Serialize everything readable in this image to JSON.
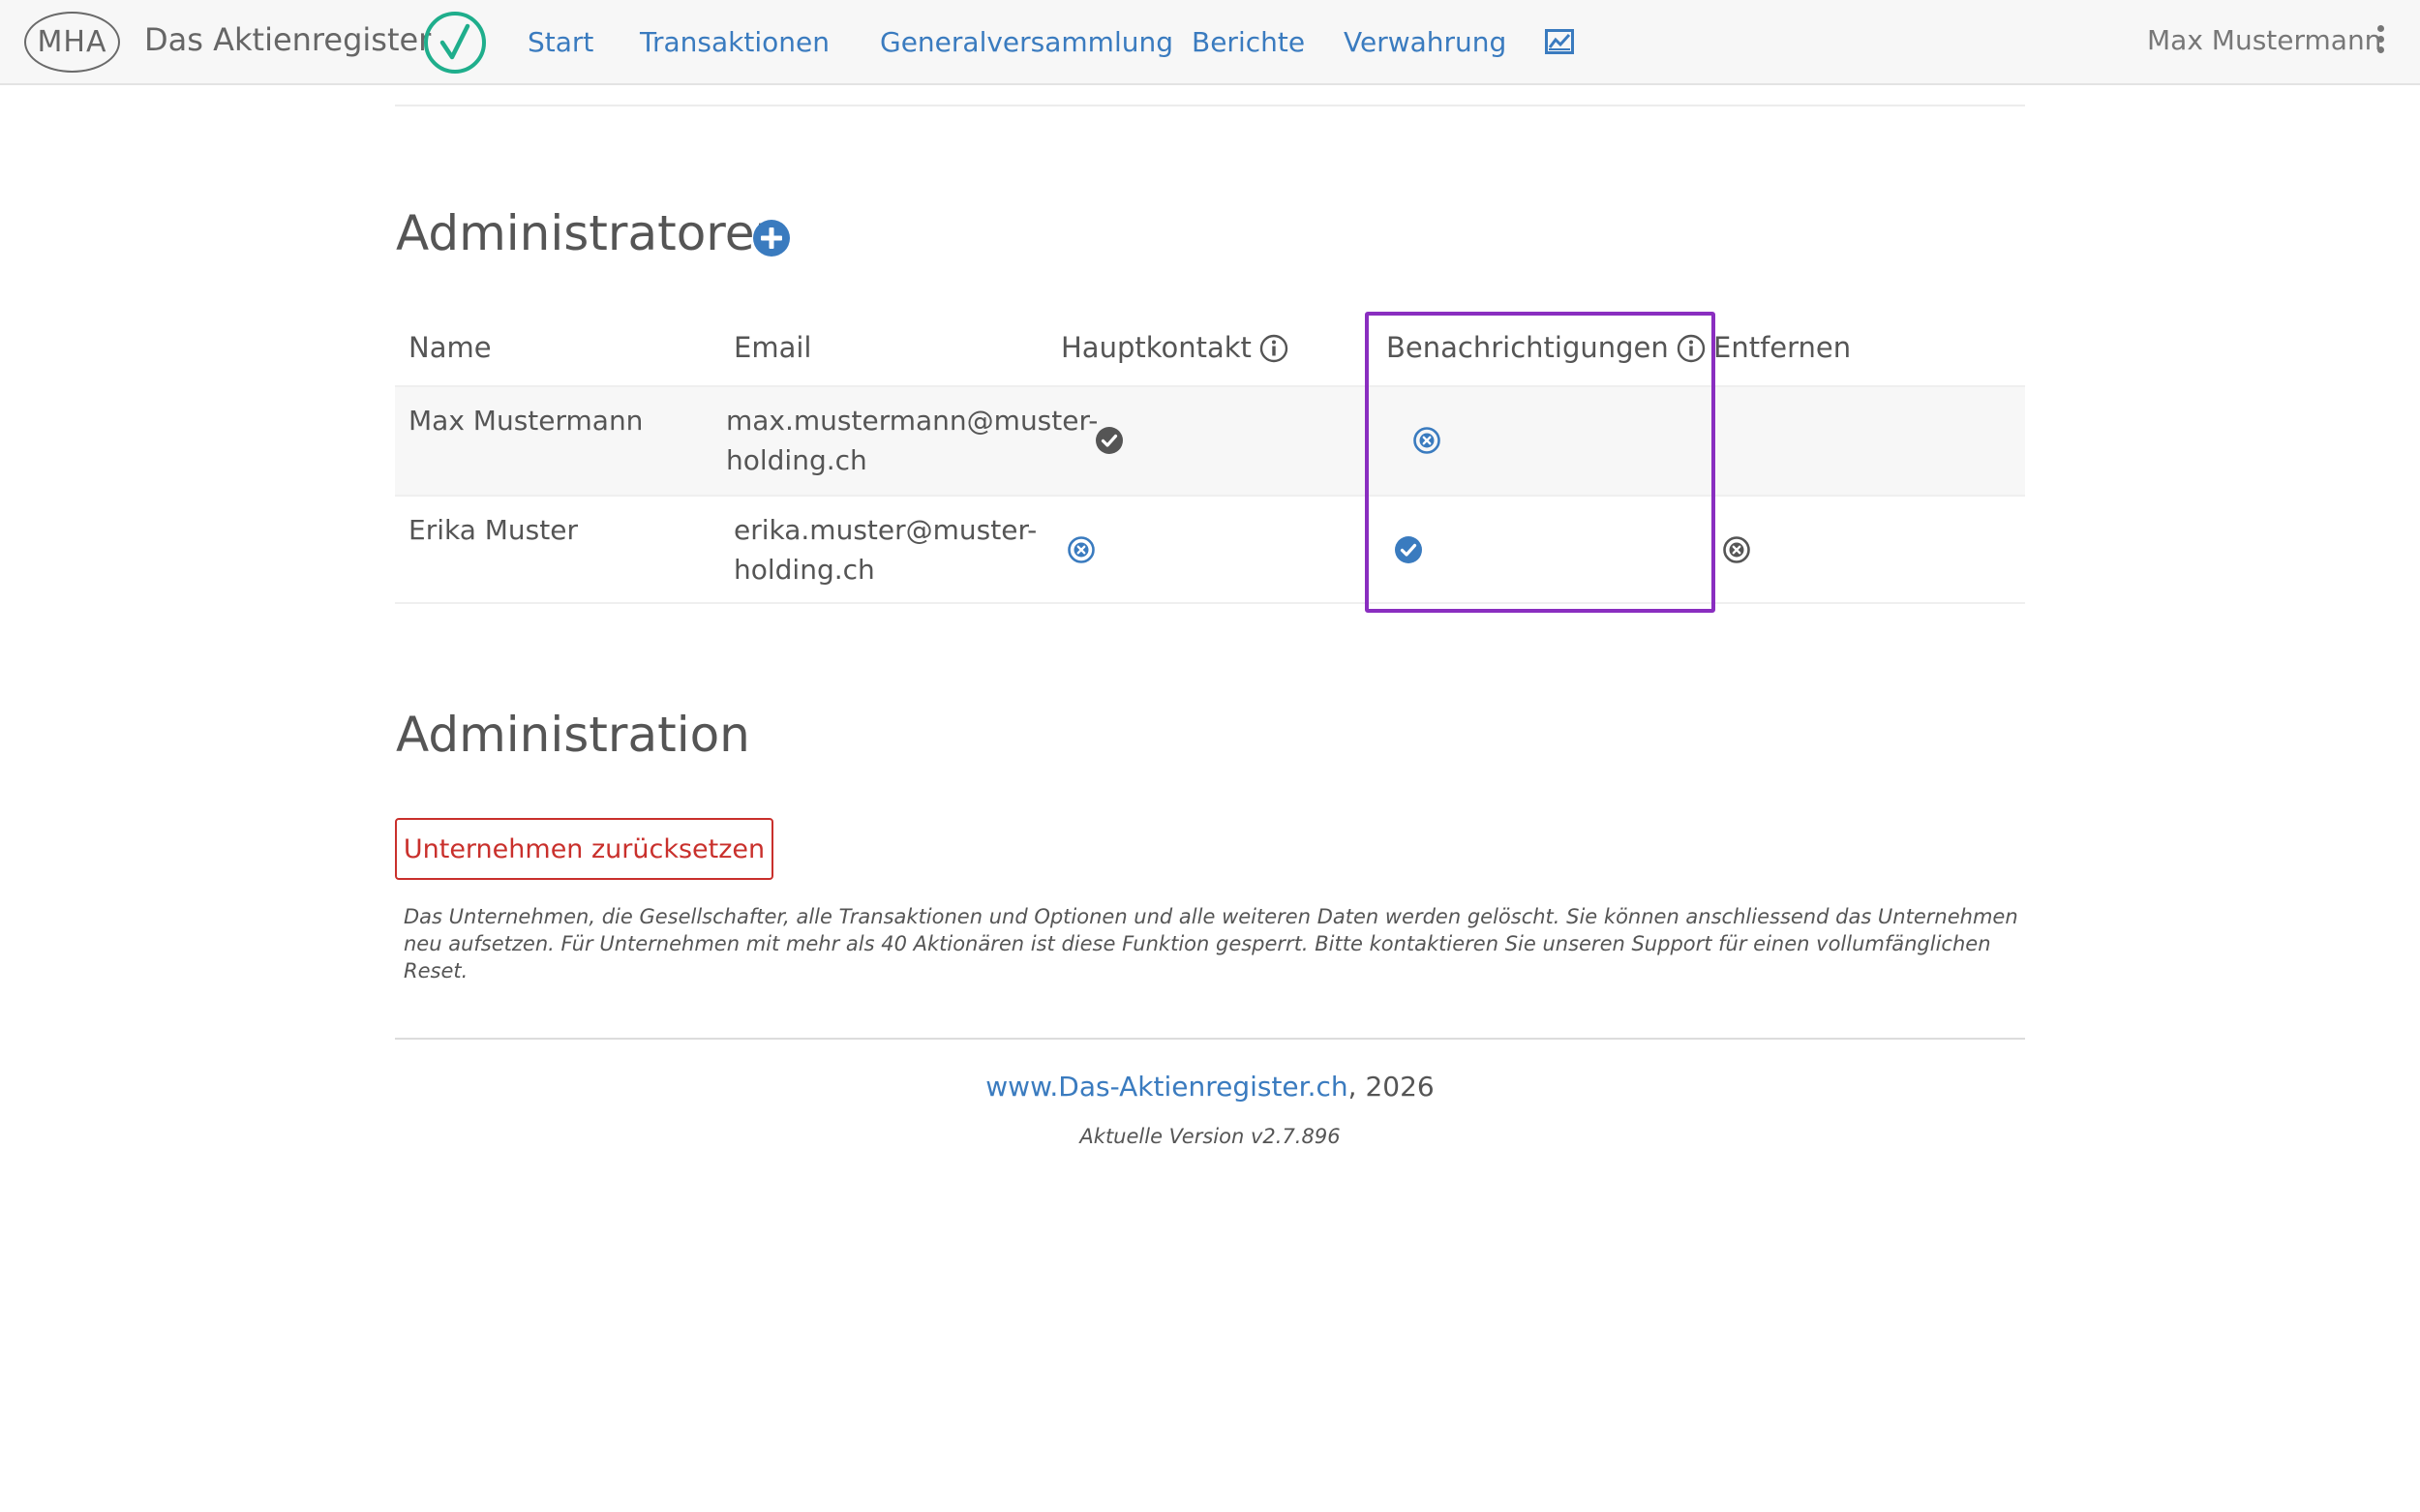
{
  "navbar": {
    "logo_text": "MHA",
    "brand": "Das Aktienregister",
    "check_icon": "checkmark-circle-icon",
    "links": [
      "Start",
      "Transaktionen",
      "Generalversammlung",
      "Berichte",
      "Verwahrung"
    ],
    "chart_icon": "chart-icon",
    "user": "Max Mustermann",
    "menu_icon": "kebab-menu-icon"
  },
  "admins": {
    "title": "Administratoren",
    "add_icon": "plus-circle-icon",
    "columns": {
      "name": "Name",
      "email": "Email",
      "main_contact": "Hauptkontakt",
      "notifications": "Benachrichtigungen",
      "remove": "Entfernen"
    },
    "rows": [
      {
        "name": "Max Mustermann",
        "email_line1": "max.mustermann@muster-",
        "email_line2": "holding.ch",
        "main_contact": "check-circle-gray-icon",
        "notifications": "x-circle-outline-blue-icon",
        "remove": ""
      },
      {
        "name": "Erika Muster",
        "email_line1": "erika.muster@muster-",
        "email_line2": "holding.ch",
        "main_contact": "x-circle-outline-blue-icon",
        "notifications": "check-circle-blue-icon",
        "remove": "x-circle-outline-gray-icon"
      }
    ]
  },
  "administration": {
    "title": "Administration",
    "reset_button": "Unternehmen zurücksetzen",
    "reset_note": "Das Unternehmen, die Gesellschafter, alle Transaktionen und Optionen und alle weiteren Daten werden gelöscht. Sie können anschliessend das Unternehmen neu aufsetzen. Für Unternehmen mit mehr als 40 Aktionären ist diese Funktion gesperrt. Bitte kontaktieren Sie unseren Support für einen vollumfänglichen Reset."
  },
  "footer": {
    "link": "www.Das-Aktienregister.ch",
    "year_text": ", 2026",
    "version": "Aktuelle Version v2.7.896"
  },
  "colors": {
    "link_blue": "#3a7bbf",
    "brand_green": "#1fae8c",
    "danger_red": "#c9302c",
    "highlight_purple": "#8a2ec0"
  }
}
